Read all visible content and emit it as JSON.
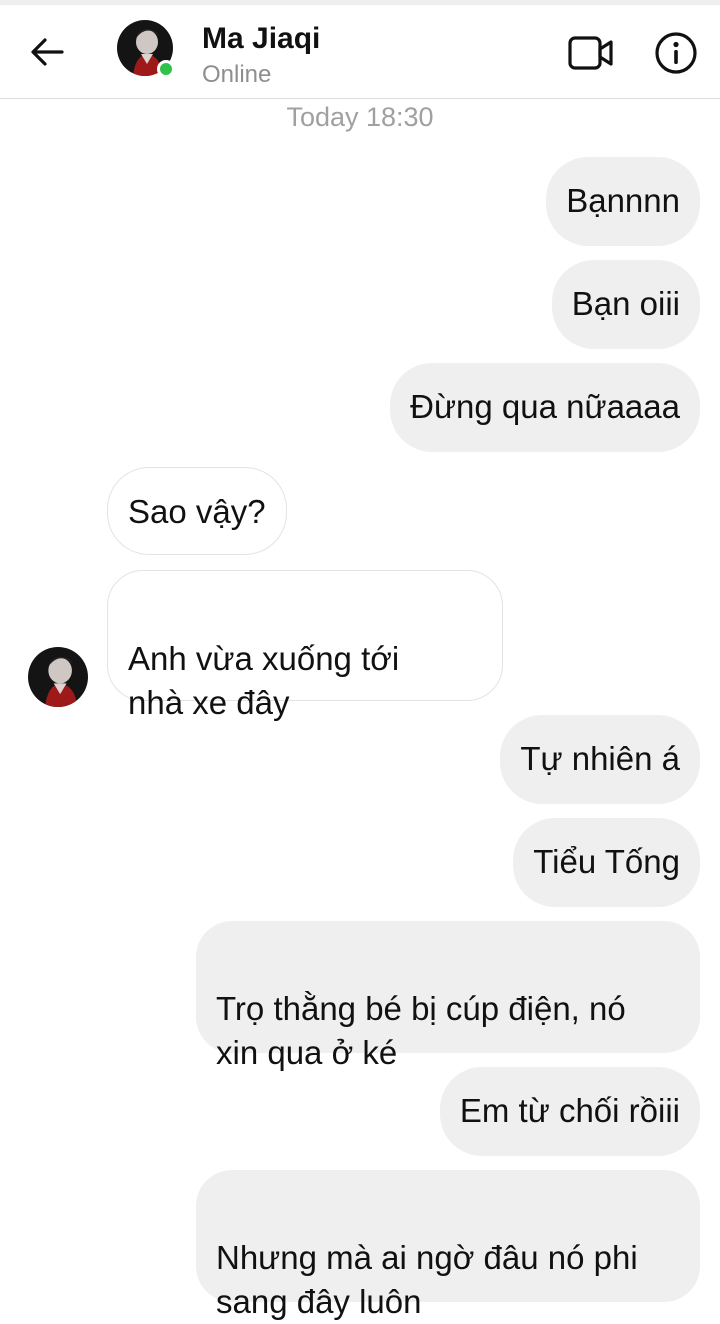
{
  "header": {
    "contact_name": "Ma Jiaqi",
    "status": "Online",
    "back_icon": "arrow-left-icon",
    "video_icon": "video-camera-icon",
    "info_icon": "info-icon",
    "online_color": "#31c24b"
  },
  "conversation": {
    "timestamp": "Today 18:30",
    "messages": [
      {
        "direction": "sent",
        "text": "Bạnnnn"
      },
      {
        "direction": "sent",
        "text": "Bạn oiii"
      },
      {
        "direction": "sent",
        "text": "Đừng qua nữaaaa"
      },
      {
        "direction": "received",
        "text": "Sao vậy?"
      },
      {
        "direction": "received",
        "text": "Anh vừa xuống tới\nnhà xe đây"
      },
      {
        "direction": "sent",
        "text": "Tự nhiên á"
      },
      {
        "direction": "sent",
        "text": "Tiểu Tống"
      },
      {
        "direction": "sent",
        "text": "Trọ thằng bé bị cúp điện, nó\nxin qua ở ké"
      },
      {
        "direction": "sent",
        "text": "Em từ chối rồiii"
      },
      {
        "direction": "sent",
        "text": "Nhưng mà ai ngờ đâu nó phi\nsang đây luôn"
      }
    ]
  },
  "colors": {
    "sent_bubble": "#efefef",
    "received_bubble": "#ffffff",
    "timestamp": "#a0a0a0"
  }
}
